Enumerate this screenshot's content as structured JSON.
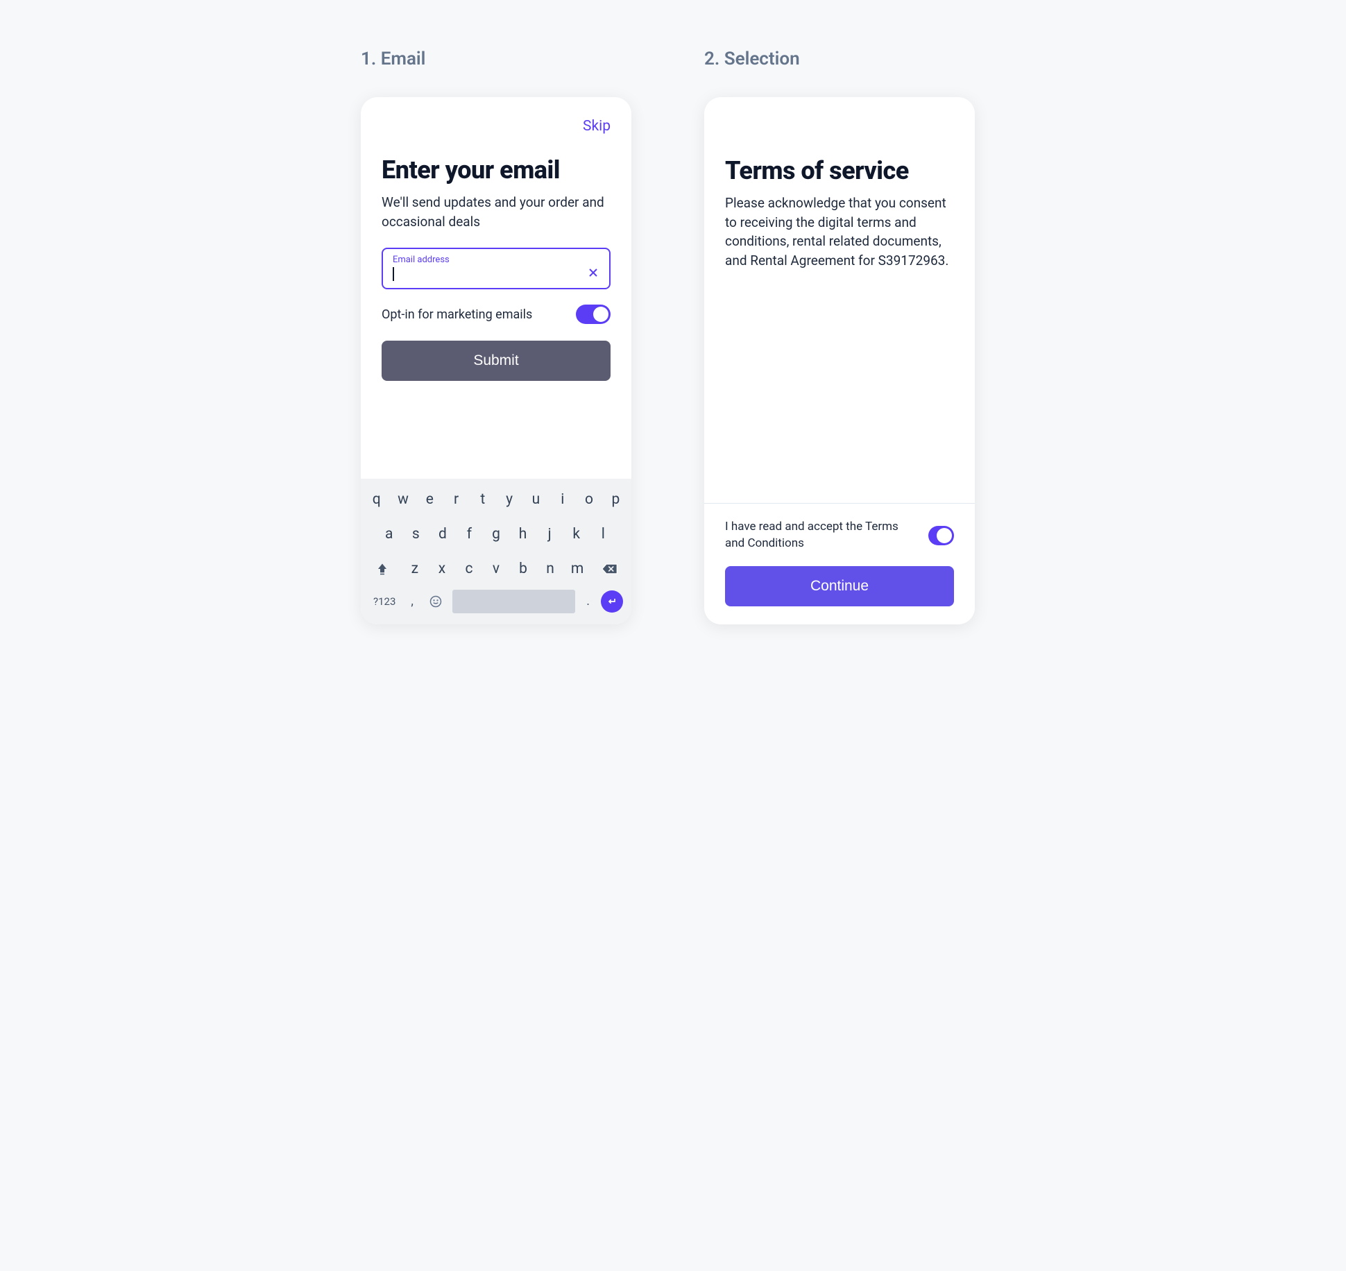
{
  "section1": {
    "title": "1. Email",
    "skip": "Skip",
    "heading": "Enter your email",
    "subheading": "We'll send updates and your order and occasional deals",
    "email_label": "Email address",
    "optin_label": "Opt-in for marketing emails",
    "submit": "Submit"
  },
  "section2": {
    "title": "2. Selection",
    "heading": "Terms of service",
    "body": "Please acknowledge that you consent to receiving the digital terms and conditions, rental related documents, and Rental Agreement for S39172963.",
    "accept_label": "I have read and accept the Terms and Conditions",
    "continue": "Continue"
  },
  "keyboard": {
    "row1": [
      "q",
      "w",
      "e",
      "r",
      "t",
      "y",
      "u",
      "i",
      "o",
      "p"
    ],
    "row2": [
      "a",
      "s",
      "d",
      "f",
      "g",
      "h",
      "j",
      "k",
      "l"
    ],
    "row3": [
      "z",
      "x",
      "c",
      "v",
      "b",
      "n",
      "m"
    ],
    "numkey": "?123"
  }
}
